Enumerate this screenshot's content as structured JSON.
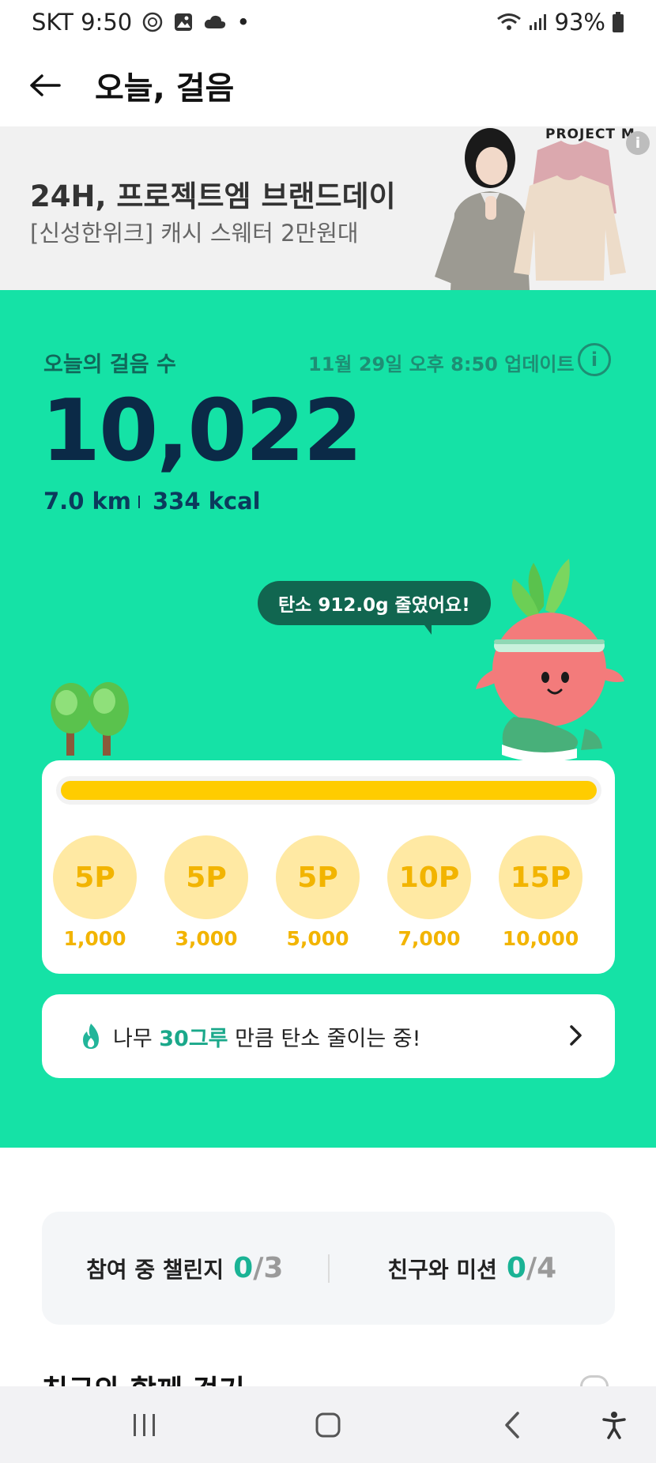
{
  "status_bar": {
    "carrier_time": "SKT 9:50",
    "dot": "•",
    "battery": "93%"
  },
  "header": {
    "title": "오늘, 걸음"
  },
  "banner": {
    "title": "24H, 프로젝트엠 브랜드데이",
    "subtitle": "[신성한위크] 캐시 스웨터 2만원대",
    "brand": "PROJECT M",
    "info_glyph": "i"
  },
  "steps": {
    "label": "오늘의 걸음 수",
    "updated": "11월 29일 오후 8:50 업데이트",
    "info_glyph": "i",
    "count": "10,022",
    "distance": "7.0 km",
    "calories": "334 kcal"
  },
  "bubble": {
    "text": "탄소 912.0g 줄였어요!"
  },
  "progress": {
    "fraction": 1.0,
    "rewards": [
      {
        "points": "5P",
        "steps": "1,000"
      },
      {
        "points": "5P",
        "steps": "3,000"
      },
      {
        "points": "5P",
        "steps": "5,000"
      },
      {
        "points": "10P",
        "steps": "7,000"
      },
      {
        "points": "15P",
        "steps": "10,000"
      }
    ]
  },
  "tree_message": {
    "prefix": "나무 ",
    "highlight": "30그루",
    "suffix": " 만큼 탄소 줄이는 중!"
  },
  "challenges": {
    "participating_label": "참여 중 챌린지",
    "participating_done": "0",
    "participating_total": "/3",
    "friends_label": "친구와 미션",
    "friends_done": "0",
    "friends_total": "/4"
  },
  "section": {
    "title": "친구와 함께 걷기"
  },
  "colors": {
    "green_bg": "#15e2a6",
    "progress_fill": "#ffcc00",
    "accent_teal": "#1ab395",
    "step_count": "#0b2a47"
  }
}
